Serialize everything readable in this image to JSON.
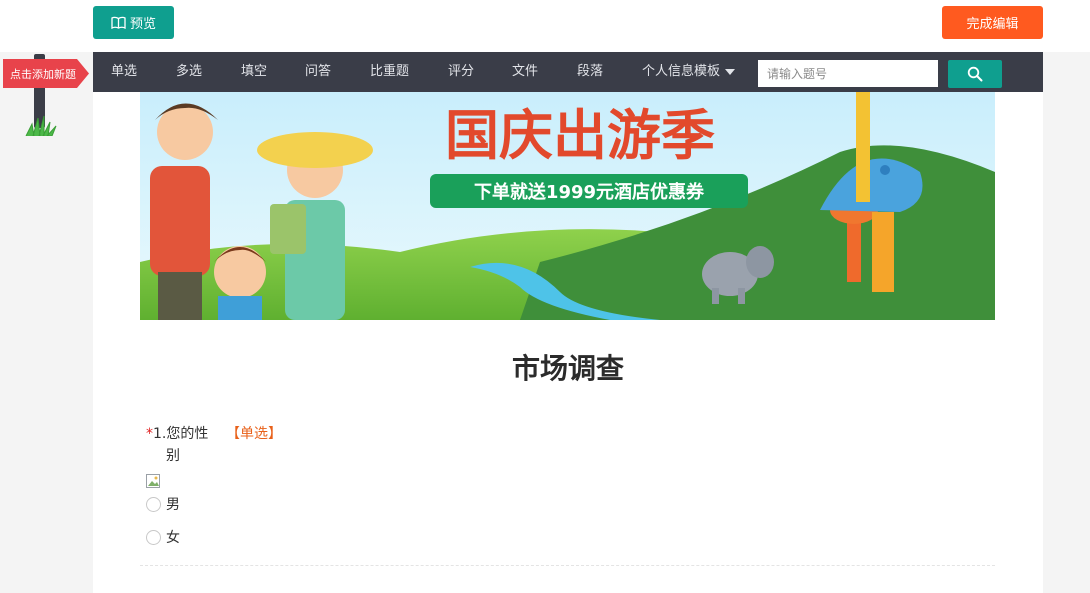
{
  "top": {
    "preview_label": "预览",
    "finish_label": "完成编辑"
  },
  "signpost": {
    "label": "点击添加新题"
  },
  "toolbar": {
    "items": [
      "单选",
      "多选",
      "填空",
      "问答",
      "比重题",
      "评分",
      "文件",
      "段落",
      "个人信息模板"
    ],
    "search_placeholder": "请输入题号"
  },
  "banner": {
    "headline": "国庆出游季",
    "promo": "下单就送1999元酒店优惠券"
  },
  "survey": {
    "title": "市场调查",
    "questions": [
      {
        "required_mark": "*",
        "number_prefix": "1.您的性",
        "text_wrap": "别",
        "type_tag": "【单选】",
        "options": [
          "男",
          "女"
        ]
      }
    ]
  },
  "colors": {
    "accent_teal": "#0f9f8f",
    "accent_orange": "#ff5a1f",
    "toolbar_bg": "#3a3d48",
    "sign_red": "#e8434b",
    "required_red": "#e02020",
    "type_orange": "#e8611a"
  }
}
